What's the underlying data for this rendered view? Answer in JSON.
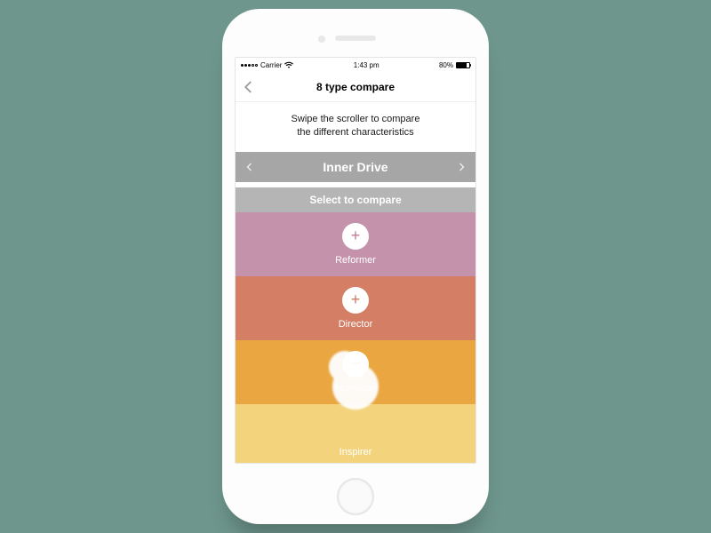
{
  "statusbar": {
    "carrier": "Carrier",
    "wifi_icon": "wifi",
    "time": "1:43 pm",
    "battery_pct": "80%"
  },
  "navbar": {
    "back_icon": "chevron-left",
    "title": "8 type compare"
  },
  "instructions": {
    "line1": "Swipe the scroller to compare",
    "line2": "the different characteristics"
  },
  "scroller": {
    "left_icon": "chevron-left",
    "title": "Inner Drive",
    "right_icon": "chevron-right"
  },
  "select_header": "Select to compare",
  "types": [
    {
      "label": "Reformer",
      "key": "reformer",
      "plus": "+"
    },
    {
      "label": "Director",
      "key": "director",
      "plus": "+"
    },
    {
      "label": "Motivator",
      "key": "motivator",
      "plus": "+"
    },
    {
      "label": "Inspirer",
      "key": "inspirer",
      "plus": "+"
    }
  ]
}
